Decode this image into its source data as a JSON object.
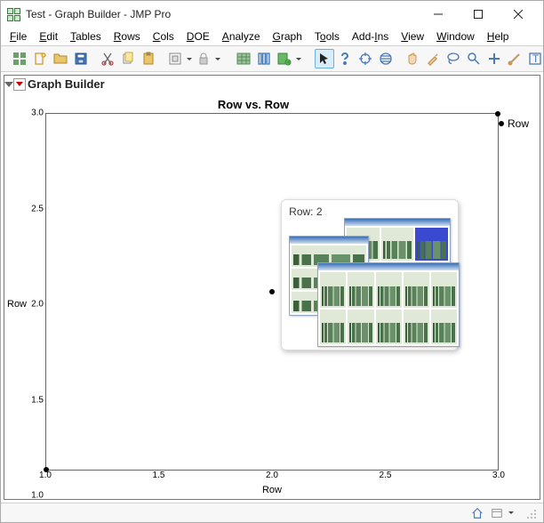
{
  "titlebar": {
    "text": "Test - Graph Builder - JMP Pro"
  },
  "menu": {
    "file": "File",
    "edit": "Edit",
    "tables": "Tables",
    "rows": "Rows",
    "cols": "Cols",
    "doe": "DOE",
    "analyze": "Analyze",
    "graph": "Graph",
    "tools": "Tools",
    "addins": "Add-Ins",
    "view": "View",
    "window": "Window",
    "help": "Help"
  },
  "outline": {
    "title": "Graph Builder"
  },
  "chart_data": {
    "type": "scatter",
    "title": "Row vs. Row",
    "xlabel": "Row",
    "ylabel": "Row",
    "xlim": [
      1.0,
      3.0
    ],
    "ylim": [
      1.0,
      3.0
    ],
    "xticks": [
      1.0,
      1.5,
      2.0,
      2.5,
      3.0
    ],
    "yticks": [
      1.0,
      1.5,
      2.0,
      2.5,
      3.0
    ],
    "series": [
      {
        "name": "Row",
        "x": [
          1,
          2,
          3
        ],
        "y": [
          1,
          2,
          3
        ]
      }
    ],
    "legend": {
      "items": [
        "Row"
      ]
    }
  },
  "hover_label": {
    "text": "Row:  2"
  }
}
